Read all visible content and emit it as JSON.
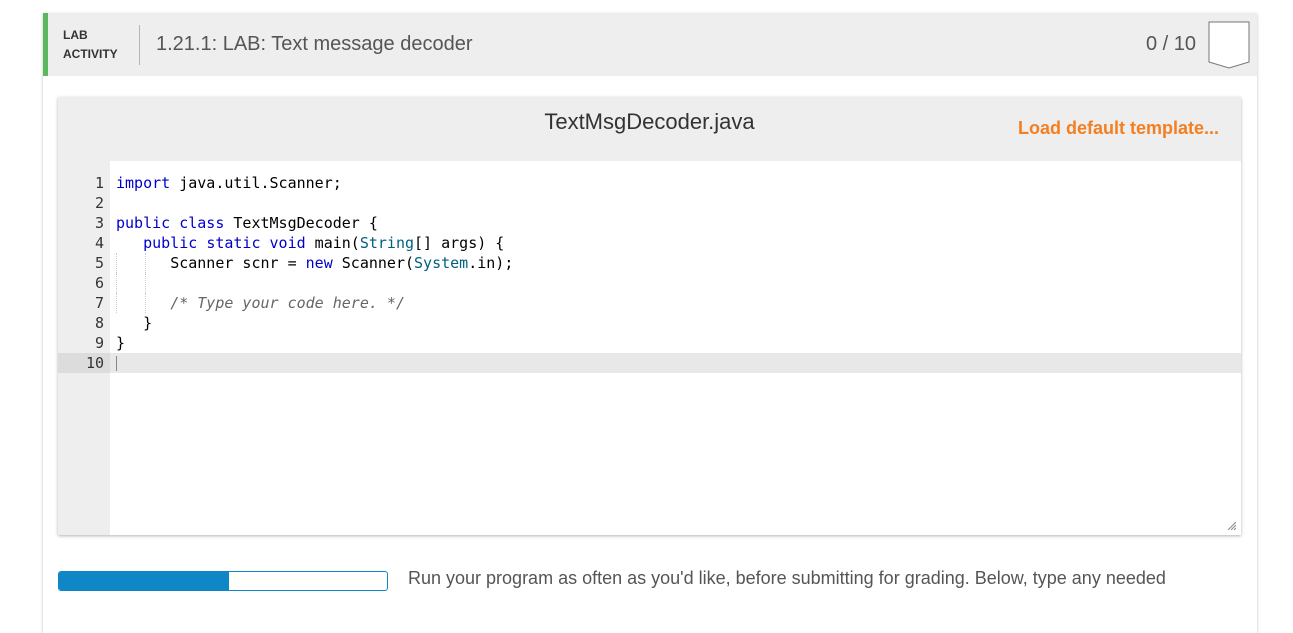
{
  "lab": {
    "type_line1": "LAB",
    "type_line2": "ACTIVITY",
    "title": "1.21.1: LAB: Text message decoder",
    "score": "0 / 10",
    "accent_color": "#5cb85c"
  },
  "editor": {
    "file_name": "TextMsgDecoder.java",
    "load_template_label": "Load default template...",
    "active_line": 10,
    "line_numbers": [
      "1",
      "2",
      "3",
      "4",
      "5",
      "6",
      "7",
      "8",
      "9",
      "10"
    ],
    "code": {
      "l1_kw": "import",
      "l1_rest": " java.util.Scanner;",
      "l3_kw1": "public",
      "l3_kw2": "class",
      "l3_rest": " TextMsgDecoder {",
      "l4_kw1": "public",
      "l4_kw2": "static",
      "l4_kw3": "void",
      "l4_mid": " main(",
      "l4_type": "String",
      "l4_rest": "[] args) {",
      "l5_a": "Scanner scnr = ",
      "l5_kw": "new",
      "l5_b": " Scanner(",
      "l5_type": "System",
      "l5_c": ".in);",
      "l7_comment": "/* Type your code here. */",
      "l8": "}",
      "l9": "}"
    }
  },
  "footer": {
    "instructions": "Run your program as often as you'd like, before submitting for grading. Below, type any needed"
  }
}
